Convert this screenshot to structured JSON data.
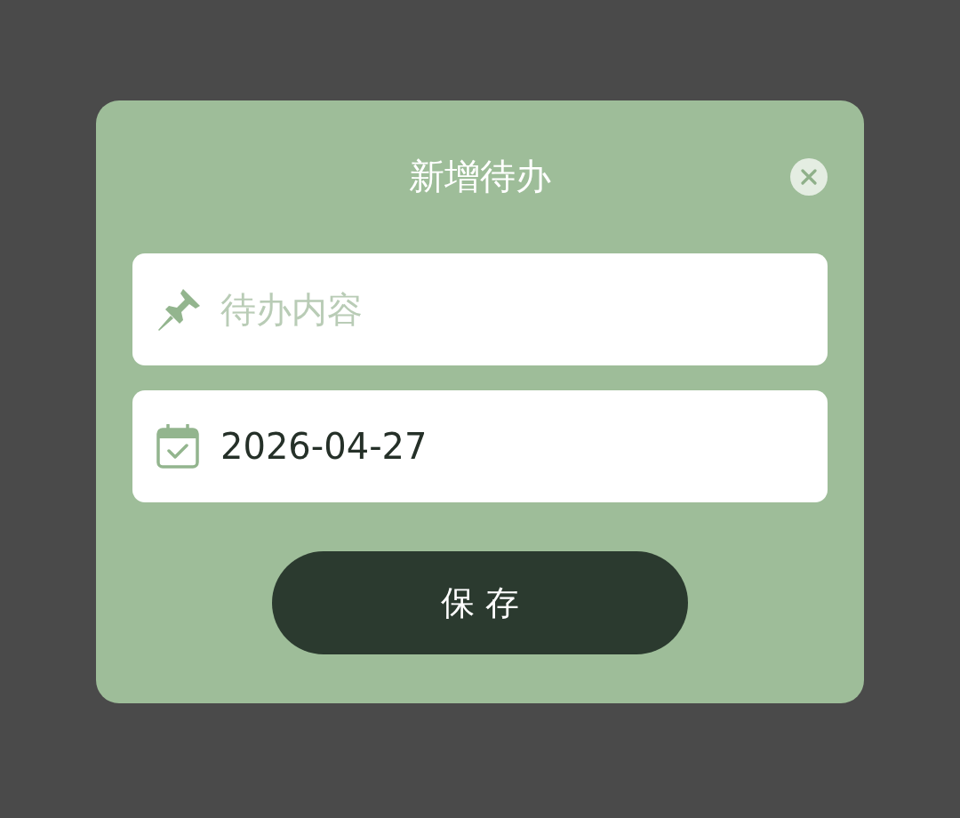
{
  "dialog": {
    "title": "新增待办",
    "content_field": {
      "placeholder": "待办内容"
    },
    "date_field": {
      "value": "2026-04-27"
    },
    "save_button": {
      "label": "保 存"
    }
  }
}
